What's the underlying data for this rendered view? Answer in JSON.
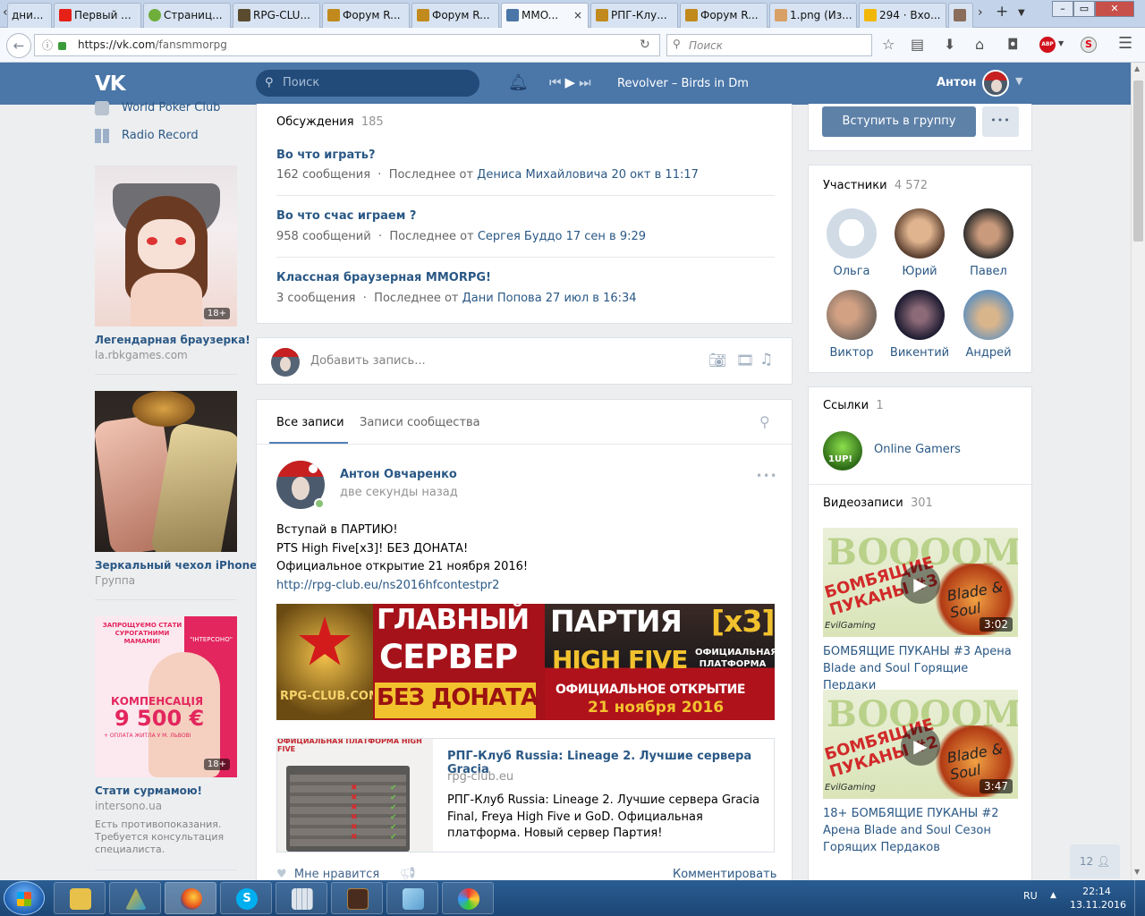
{
  "browser": {
    "tabs": [
      {
        "label": "дни...",
        "color": "#7a7a7a"
      },
      {
        "label": "Первый ...",
        "color": "#e62117"
      },
      {
        "label": "Страниц...",
        "color": "#6fae3b"
      },
      {
        "label": "RPG-CLU...",
        "color": "#5a4b2e"
      },
      {
        "label": "Форум R...",
        "color": "#c28a1c"
      },
      {
        "label": "Форум R...",
        "color": "#c28a1c"
      },
      {
        "label": "MMO...",
        "color": "#4a76a8"
      },
      {
        "label": "РПГ-Клу...",
        "color": "#c28a1c"
      },
      {
        "label": "Форум R...",
        "color": "#c28a1c"
      },
      {
        "label": "1.png (Из...",
        "color": "#d9a066"
      },
      {
        "label": "294 · Вхо...",
        "color": "#f2b705"
      }
    ],
    "close_glyph": "×",
    "new_tab_glyph": "+",
    "url_host": "https://vk.com",
    "url_path": "/fansmmorpg",
    "search_placeholder": "Поиск"
  },
  "vk": {
    "search_placeholder": "Поиск",
    "track": "Revolver – Birds in Dm",
    "user_name": "Антон"
  },
  "left": {
    "links": [
      "World Poker Club",
      "Radio Record"
    ],
    "ads": [
      {
        "title": "Легендарная браузерка!",
        "subtitle": "la.rbkgames.com",
        "badge": "18+"
      },
      {
        "title": "Зеркальный чехол iPhone",
        "subtitle": "Группа"
      },
      {
        "title": "Стати сурмамою!",
        "subtitle": "intersono.ua",
        "note": "Есть противопоказания. Требуется консультация специалиста.",
        "badge": "18+",
        "image_text": {
          "top": "ЗАПРОЩУЄМО СТАТИ СУРОГАТНИМИ МАМАМИ!",
          "brand": "\"ІНТЕРСОНО\"",
          "comp": "КОМПЕНСАЦІЯ",
          "sum": "9 500 €",
          "small": "+ ОПЛАТА ЖИТЛА У М. ЛЬВОВІ"
        }
      }
    ]
  },
  "discussions": {
    "label": "Обсуждения",
    "count": "185",
    "items": [
      {
        "title": "Во что играть?",
        "count": "162 сообщения",
        "sep": "·",
        "last_prefix": "Последнее от",
        "last": "Дениса Михайловича 20 окт в 11:17"
      },
      {
        "title": "Во что счас играем ?",
        "count": "958 сообщений",
        "sep": "·",
        "last_prefix": "Последнее от",
        "last": "Сергея Буддо 17 сен в 9:29"
      },
      {
        "title": "Классная браузерная MMORPG!",
        "count": "3 сообщения",
        "sep": "·",
        "last_prefix": "Последнее от",
        "last": "Дани Попова 27 июл в 16:34"
      }
    ]
  },
  "composer": {
    "placeholder": "Добавить запись..."
  },
  "feed_tabs": {
    "all": "Все записи",
    "community": "Записи сообщества"
  },
  "post": {
    "author": "Антон Овчаренко",
    "time": "две секунды назад",
    "lines": [
      "Вступай в ПАРТИЮ!",
      "PTS High Five[x3]! БЕЗ ДОНАТА!",
      "Официальное открытие 21 ноября 2016!"
    ],
    "link": "http://rpg-club.eu/ns2016hfcontestpr2",
    "banner": {
      "l1": "ГЛАВНЫЙ",
      "l2": "СЕРВЕР",
      "l3": "БЕЗ ДОНАТА",
      "r1": "ПАРТИЯ",
      "r1b": "[x3]",
      "r2": "HIGH FIVE",
      "r2b": "ОФИЦИАЛЬНАЯ ПЛАТФОРМА",
      "r3": "ОФИЦИАЛЬНОЕ ОТКРЫТИЕ",
      "r4": "21 ноября 2016",
      "site": "RPG-CLUB.COM"
    },
    "snippet": {
      "title": "РПГ-Клуб Russia: Lineage 2. Лучшие сервера Gracia",
      "domain": "rpg-club.eu",
      "text": "РПГ-Клуб Russia: Lineage 2. Лучшие сервера Gracia Final, Freya High Five и GoD. Официальная платформа. Новый сервер Партия!",
      "thumb_caption": "ОФИЦИАЛЬНАЯ ПЛАТФОРМА HIGH FIVE"
    },
    "like": "Мне нравится",
    "comment": "Комментировать"
  },
  "right": {
    "join": "Вступить в группу",
    "more": "•••",
    "members_label": "Участники",
    "members_count": "4 572",
    "members": [
      "Ольга",
      "Юрий",
      "Павел",
      "Виктор",
      "Викентий",
      "Андрей"
    ],
    "links_label": "Ссылки",
    "links_count": "1",
    "link_name": "Online Gamers",
    "link_icon_text": "1UP!",
    "videos_label": "Видеозаписи",
    "videos_count": "301",
    "videos": [
      {
        "title": "БОМБЯЩИЕ ПУКАНЫ #3 Арена Blade and Soul Горящие Пердаки",
        "duration": "3:02",
        "overlay": "БОМБЯЩИЕ ПУКАНЫ #3",
        "bg": "BOOOOM",
        "studio": "EvilGaming",
        "logo": "Blade & Soul"
      },
      {
        "title": "18+ БОМБЯЩИЕ ПУКАНЫ #2 Арена Blade and Soul Сезон Горящих Пердаков",
        "duration": "3:47",
        "overlay": "БОМБЯЩИЕ ПУКАНЫ #2",
        "bg": "BOOOOM",
        "studio": "EvilGaming",
        "logo": "Blade & Soul"
      }
    ],
    "online_badge": "12"
  },
  "taskbar": {
    "lang": "RU",
    "time": "22:14",
    "date": "13.11.2016"
  }
}
